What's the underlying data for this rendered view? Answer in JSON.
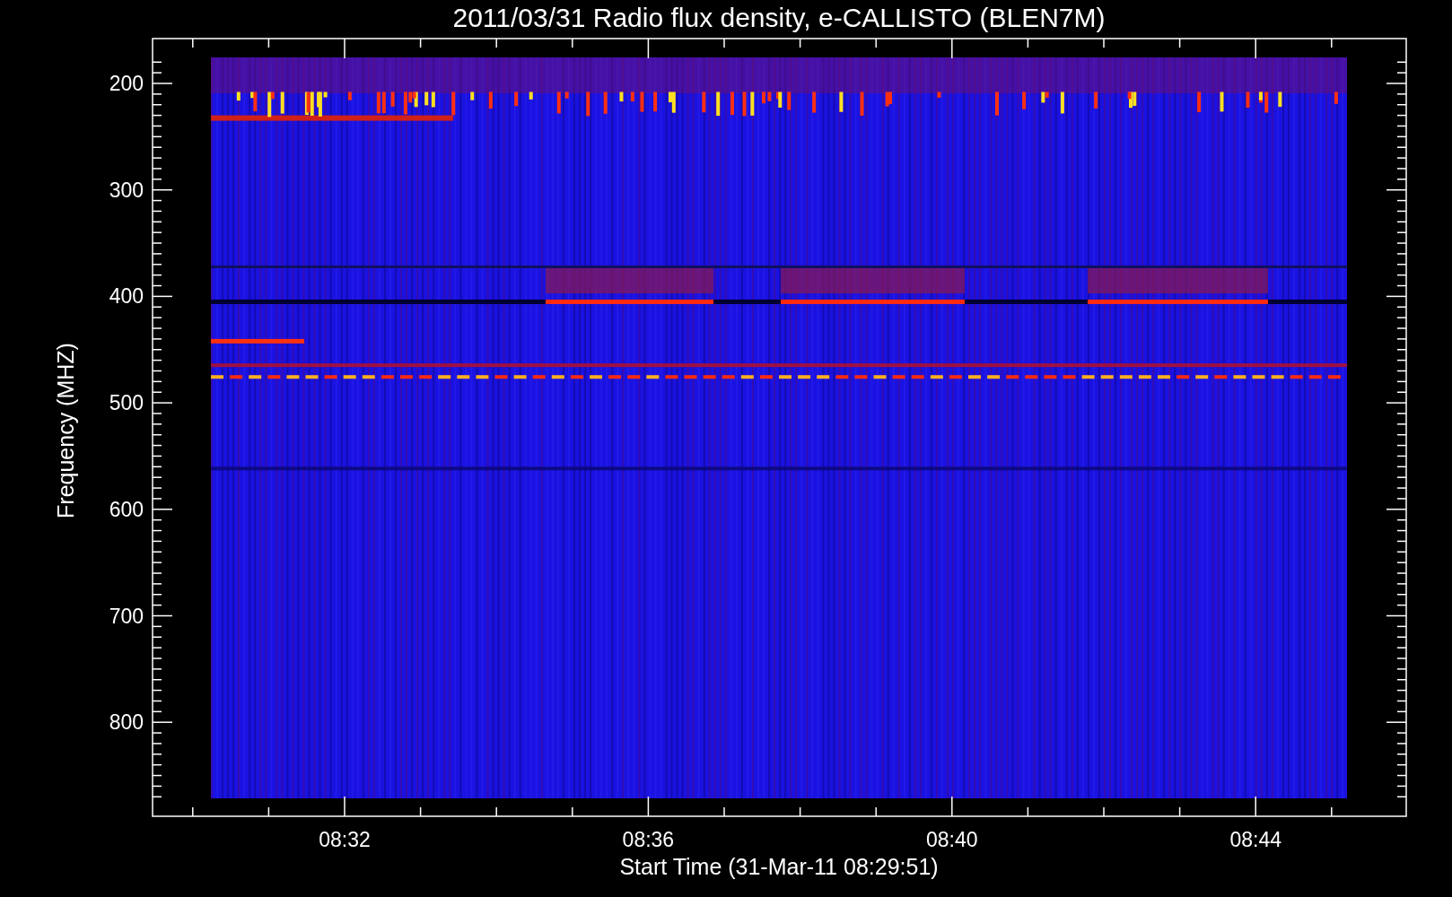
{
  "title": "2011/03/31  Radio flux density, e-CALLISTO (BLEN7M)",
  "y_axis": {
    "label": "Frequency (MHZ)",
    "ticks": [
      "200",
      "300",
      "400",
      "500",
      "600",
      "700",
      "800"
    ]
  },
  "x_axis": {
    "label": "Start Time (31-Mar-11 08:29:51)",
    "ticks": [
      "08:32",
      "08:36",
      "08:40",
      "08:44"
    ]
  }
}
